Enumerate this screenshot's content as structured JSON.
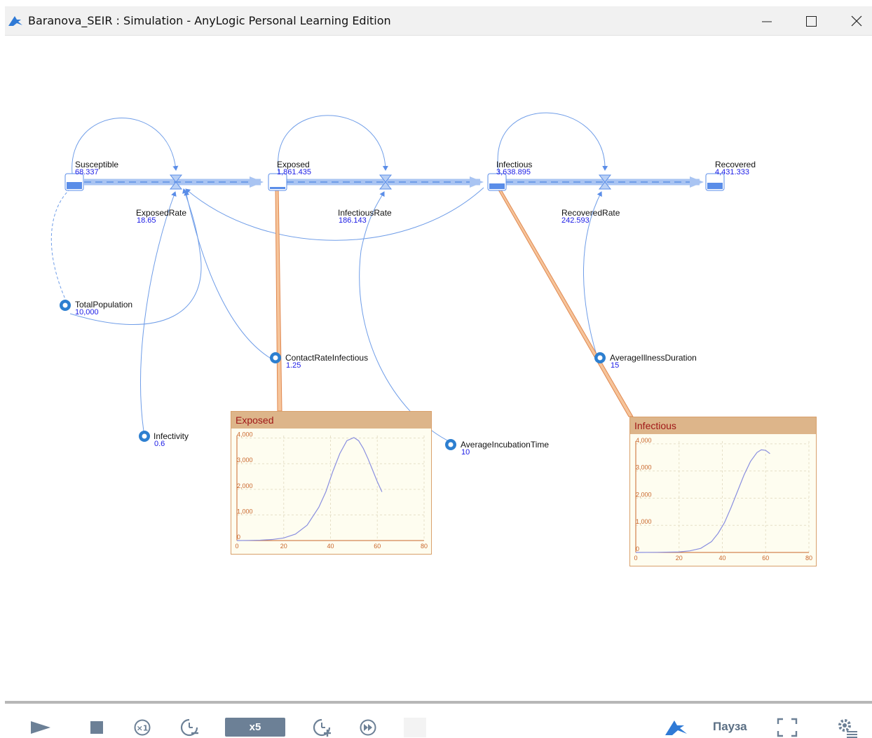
{
  "window": {
    "title": "Baranova_SEIR : Simulation - AnyLogic Personal Learning Edition",
    "minimize_icon": "minimize-icon",
    "maximize_icon": "maximize-icon",
    "close_icon": "close-icon"
  },
  "model": {
    "stocks": [
      {
        "name": "Susceptible",
        "value": "68.337"
      },
      {
        "name": "Exposed",
        "value": "1,861.435"
      },
      {
        "name": "Infectious",
        "value": "3,638.895"
      },
      {
        "name": "Recovered",
        "value": "4,431.333"
      }
    ],
    "flows": [
      {
        "name": "ExposedRate",
        "value": "18.65"
      },
      {
        "name": "InfectiousRate",
        "value": "186.143"
      },
      {
        "name": "RecoveredRate",
        "value": "242.593"
      }
    ],
    "parameters": [
      {
        "name": "TotalPopulation",
        "value": "10,000"
      },
      {
        "name": "ContactRateInfectious",
        "value": "1.25"
      },
      {
        "name": "AverageIllnessDuration",
        "value": "15"
      },
      {
        "name": "Infectivity",
        "value": "0.6"
      },
      {
        "name": "AverageIncubationTime",
        "value": "10"
      }
    ]
  },
  "chart_data": [
    {
      "type": "line",
      "title": "Exposed",
      "xlabel": "",
      "ylabel": "",
      "x_ticks": [
        "0",
        "20",
        "40",
        "60",
        "80"
      ],
      "y_ticks": [
        "0",
        "1,000",
        "2,000",
        "3,000",
        "4,000"
      ],
      "xlim": [
        0,
        80
      ],
      "ylim": [
        0,
        4100
      ],
      "grid": true,
      "series": [
        {
          "x": [
            0,
            5,
            10,
            15,
            20,
            25,
            30,
            35,
            38,
            41,
            44,
            47,
            50,
            52,
            54,
            56,
            58,
            60,
            62
          ],
          "y": [
            0,
            5,
            15,
            40,
            100,
            250,
            600,
            1300,
            1900,
            2700,
            3400,
            3900,
            4020,
            3900,
            3600,
            3200,
            2750,
            2300,
            1900
          ]
        }
      ]
    },
    {
      "type": "line",
      "title": "Infectious",
      "xlabel": "",
      "ylabel": "",
      "x_ticks": [
        "0",
        "20",
        "40",
        "60",
        "80"
      ],
      "y_ticks": [
        "0",
        "1,000",
        "2,000",
        "3,000",
        "4,000"
      ],
      "xlim": [
        0,
        80
      ],
      "ylim": [
        0,
        4100
      ],
      "grid": true,
      "series": [
        {
          "x": [
            0,
            10,
            20,
            25,
            30,
            35,
            38,
            41,
            44,
            47,
            50,
            53,
            56,
            58,
            60,
            62
          ],
          "y": [
            0,
            5,
            20,
            60,
            150,
            400,
            700,
            1100,
            1650,
            2250,
            2850,
            3350,
            3680,
            3780,
            3760,
            3640
          ]
        }
      ]
    }
  ],
  "toolbar": {
    "speed_label": "x5",
    "pause_label": "Пауза",
    "play_icon": "play-icon",
    "stop_icon": "stop-icon",
    "realtime_icon": "x1-icon",
    "slowdown_icon": "slow-down-icon",
    "speedup_icon": "speed-up-icon",
    "fastforward_icon": "fast-forward-icon",
    "anylogic_icon": "anylogic-logo-icon",
    "fullscreen_icon": "fullscreen-icon",
    "settings_icon": "settings-icon",
    "accent": "#6c8096"
  }
}
